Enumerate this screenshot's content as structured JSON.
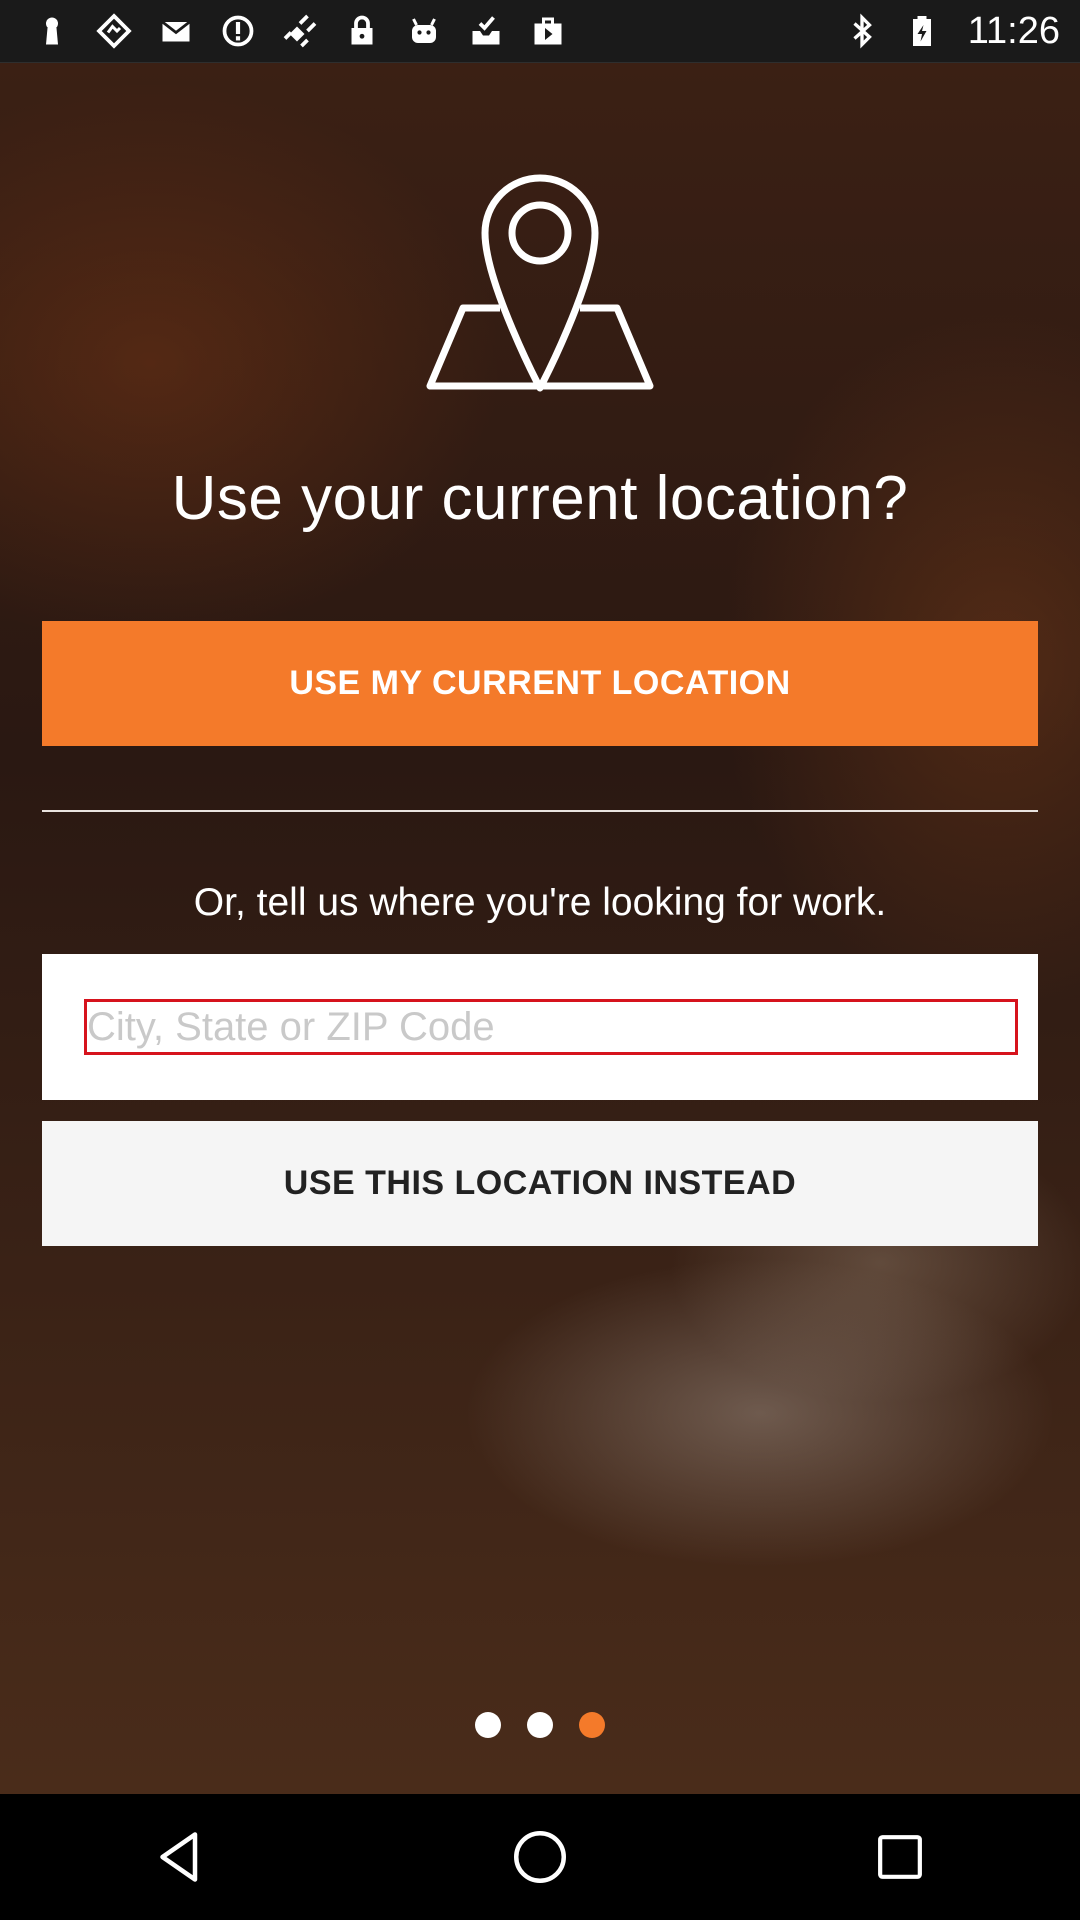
{
  "status_bar": {
    "time": "11:26",
    "left_icons": [
      "keyhole-icon",
      "diamond-nav-icon",
      "mail-icon",
      "alert-circle-icon",
      "satellite-fake-gps-icon",
      "lock-icon",
      "android-icon",
      "inbox-check-icon",
      "briefcase-play-icon"
    ],
    "right_icons": [
      "bluetooth-icon",
      "battery-icon"
    ]
  },
  "main": {
    "heading": "Use your current location?",
    "primary_button_label": "USE MY CURRENT LOCATION",
    "subheading": "Or, tell us where you're looking for work.",
    "location_input": {
      "value": "",
      "placeholder": "City, State or ZIP Code"
    },
    "secondary_button_label": "USE THIS LOCATION INSTEAD"
  },
  "pager": {
    "total": 3,
    "active_index": 2
  },
  "colors": {
    "accent": "#f47a2a",
    "input_focus_border": "#d6131d",
    "secondary_button_bg": "#f5f5f5"
  },
  "nav_bar": {
    "buttons": [
      "back-icon",
      "home-icon",
      "recents-icon"
    ]
  }
}
